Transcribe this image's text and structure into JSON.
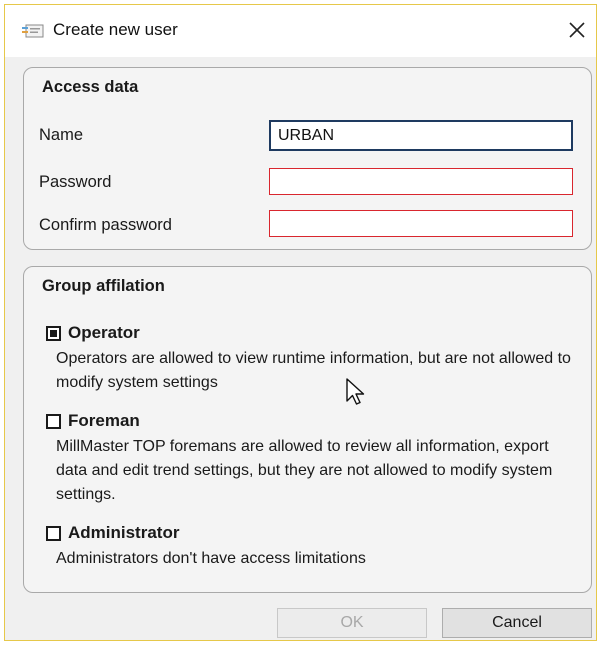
{
  "window": {
    "title": "Create new user",
    "icons": {
      "app": "user-card-icon",
      "close": "close-icon"
    }
  },
  "access": {
    "title": "Access data",
    "name_label": "Name",
    "name_value": "URBAN",
    "password_label": "Password",
    "password_value": "",
    "confirm_label": "Confirm password",
    "confirm_value": "",
    "invalid_border_color": "#d9262e"
  },
  "group": {
    "title": "Group affilation",
    "options": [
      {
        "name": "Operator",
        "checked": true,
        "desc": "Operators are allowed to view runtime information, but are not allowed to modify system settings"
      },
      {
        "name": "Foreman",
        "checked": false,
        "desc": "MillMaster TOP foremans are allowed to review all information, export data and edit trend settings, but they are not allowed to modify system settings."
      },
      {
        "name": "Administrator",
        "checked": false,
        "desc": "Administrators don't have access limitations"
      }
    ]
  },
  "buttons": {
    "ok": "OK",
    "cancel": "Cancel",
    "ok_enabled": false
  },
  "cursor_icon": "mouse-pointer-icon"
}
